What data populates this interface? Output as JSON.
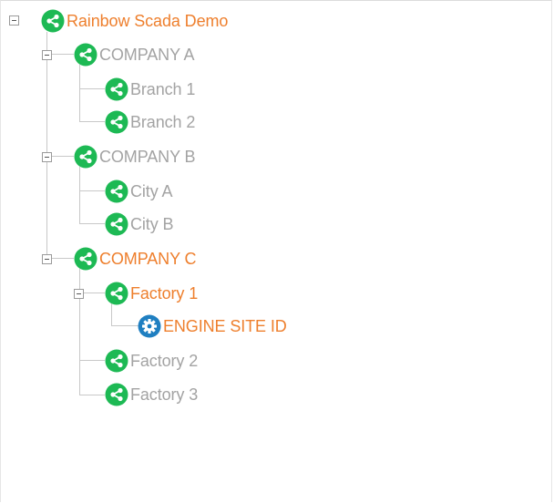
{
  "colors": {
    "active_label": "#ee7f2d",
    "muted_label": "#a3a3a3",
    "node_icon": "#1db954",
    "device_icon": "#1f7fc1",
    "connector": "#c8c8c8"
  },
  "tree": {
    "root": {
      "label": "Rainbow Scada Demo",
      "icon": "share-icon",
      "expanded": true,
      "highlighted": true
    },
    "company_a": {
      "label": "COMPANY A",
      "icon": "share-icon",
      "expanded": true,
      "highlighted": false,
      "children": [
        {
          "label": "Branch 1",
          "icon": "share-icon",
          "highlighted": false
        },
        {
          "label": "Branch 2",
          "icon": "share-icon",
          "highlighted": false
        }
      ]
    },
    "company_b": {
      "label": "COMPANY B",
      "icon": "share-icon",
      "expanded": true,
      "highlighted": false,
      "children": [
        {
          "label": "City A",
          "icon": "share-icon",
          "highlighted": false
        },
        {
          "label": "City B",
          "icon": "share-icon",
          "highlighted": false
        }
      ]
    },
    "company_c": {
      "label": "COMPANY C",
      "icon": "share-icon",
      "expanded": true,
      "highlighted": true,
      "factory1": {
        "label": "Factory 1",
        "icon": "share-icon",
        "expanded": true,
        "highlighted": true,
        "device": {
          "label": "ENGINE SITE ID",
          "icon": "gear-icon",
          "highlighted": true
        }
      },
      "factory2": {
        "label": "Factory 2",
        "icon": "share-icon",
        "highlighted": false
      },
      "factory3": {
        "label": "Factory 3",
        "icon": "share-icon",
        "highlighted": false
      }
    }
  }
}
